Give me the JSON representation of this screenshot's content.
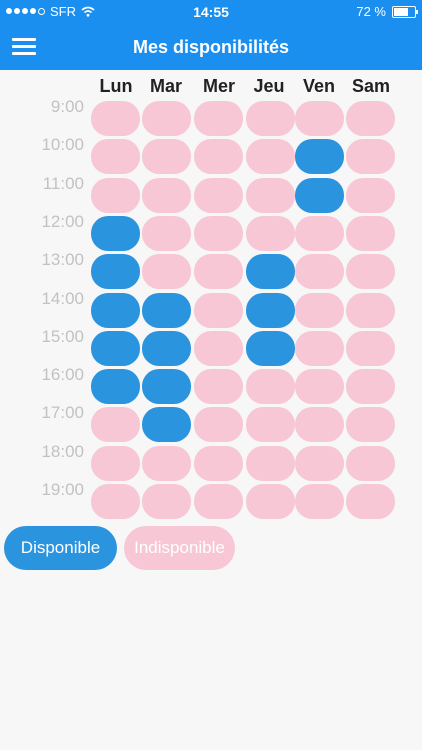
{
  "status": {
    "carrier": "SFR",
    "time": "14:55",
    "battery": "72 %",
    "battery_level": 0.72
  },
  "nav": {
    "title": "Mes disponibilités"
  },
  "days": [
    "Lun",
    "Mar",
    "Mer",
    "Jeu",
    "Ven",
    "Sam"
  ],
  "times": [
    "9:00",
    "10:00",
    "11:00",
    "12:00",
    "13:00",
    "14:00",
    "15:00",
    "16:00",
    "17:00",
    "18:00",
    "19:00"
  ],
  "availability": [
    [
      0,
      0,
      0,
      0,
      0,
      0
    ],
    [
      0,
      0,
      0,
      0,
      1,
      0
    ],
    [
      0,
      0,
      0,
      0,
      1,
      0
    ],
    [
      1,
      0,
      0,
      0,
      0,
      0
    ],
    [
      1,
      0,
      0,
      1,
      0,
      0
    ],
    [
      1,
      1,
      0,
      1,
      0,
      0
    ],
    [
      1,
      1,
      0,
      1,
      0,
      0
    ],
    [
      1,
      1,
      0,
      0,
      0,
      0
    ],
    [
      0,
      1,
      0,
      0,
      0,
      0
    ],
    [
      0,
      0,
      0,
      0,
      0,
      0
    ],
    [
      0,
      0,
      0,
      0,
      0,
      0
    ]
  ],
  "legend": {
    "available": "Disponible",
    "unavailable": "Indisponible"
  },
  "colors": {
    "accent": "#1a8ff0",
    "available": "#2b94df",
    "unavailable": "#f7c7d6"
  }
}
